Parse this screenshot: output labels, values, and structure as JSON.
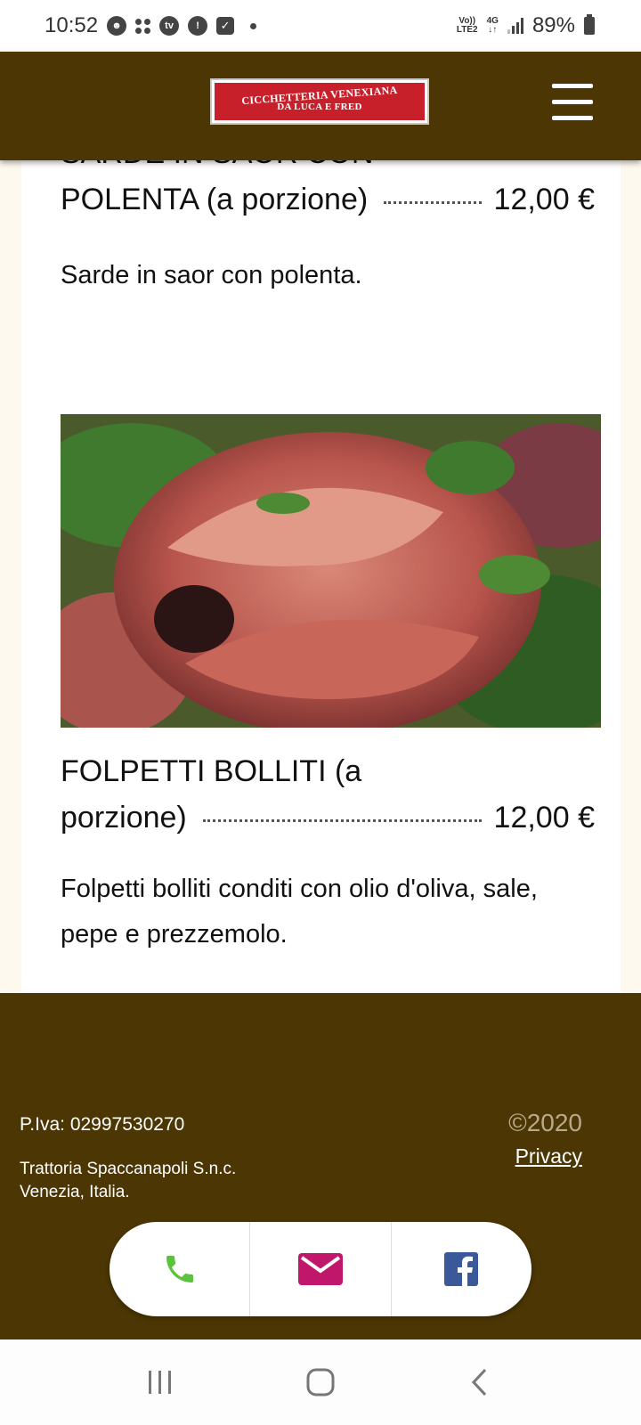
{
  "status_bar": {
    "time": "10:52",
    "network_line1": "Vo))",
    "network_line2": "LTE2",
    "network_type": "4G",
    "battery": "89%",
    "icons": [
      "face-icon",
      "dots-icon",
      "tv-icon",
      "alert-icon",
      "checkbox-icon",
      "dot-icon",
      "signal-icon",
      "battery-icon"
    ]
  },
  "header": {
    "logo_line1": "CICCHETTERIA VENEXIANA",
    "logo_line2": "DA LUCA E FRED",
    "menu_icon": "hamburger-menu-icon"
  },
  "menu_items": [
    {
      "title_cut": "SARDE IN SAOR CON",
      "title_end": "POLENTA (a porzione)",
      "price": "12,00 €",
      "description": "Sarde in saor con polenta."
    },
    {
      "title_line1": "FOLPETTI BOLLITI (a",
      "title_end": "porzione)",
      "price": "12,00 €",
      "description": "Folpetti bolliti conditi con olio d'oliva, sale, pepe e prezzemolo."
    }
  ],
  "footer": {
    "piva": "P.Iva: 02997530270",
    "company_line1": "Trattoria Spaccanapoli S.n.c.",
    "company_line2": "Venezia, Italia.",
    "copyright": "©2020",
    "privacy": "Privacy",
    "actions": [
      "phone-icon",
      "mail-icon",
      "facebook-icon"
    ]
  },
  "colors": {
    "brand_brown": "#4b3604",
    "logo_red": "#c8202a",
    "phone_green": "#5cc13b",
    "mail_magenta": "#c0176a",
    "facebook_blue": "#3b5998"
  }
}
